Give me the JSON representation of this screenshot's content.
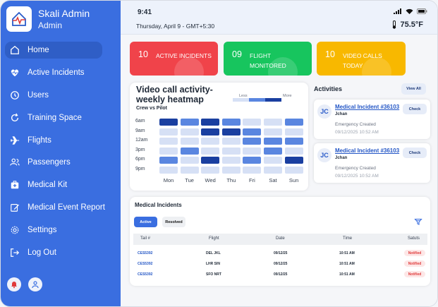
{
  "sidebar": {
    "title": "Skali Admin",
    "subtitle": "Admin",
    "items": [
      {
        "label": "Home",
        "icon": "home-icon"
      },
      {
        "label": "Active Incidents",
        "icon": "heartbeat-icon"
      },
      {
        "label": "Users",
        "icon": "clock-icon"
      },
      {
        "label": "Training Space",
        "icon": "refresh-icon"
      },
      {
        "label": "Flights",
        "icon": "plane-icon"
      },
      {
        "label": "Passengers",
        "icon": "users-icon"
      },
      {
        "label": "Medical Kit",
        "icon": "medkit-icon"
      },
      {
        "label": "Medical Event Report",
        "icon": "edit-icon"
      },
      {
        "label": "Settings",
        "icon": "gear-icon"
      },
      {
        "label": "Log Out",
        "icon": "logout-icon"
      }
    ]
  },
  "status": {
    "time": "9:41",
    "date": "Thursday, April 9 - GMT+5:30",
    "temperature": "75.5°F"
  },
  "stats": [
    {
      "number": "10",
      "label": "ACTIVE INCIDENTS",
      "color": "#f0434a"
    },
    {
      "number": "09",
      "label": "FLIGHT MONITORED",
      "color": "#17c55e"
    },
    {
      "number": "10",
      "label": "VIDEO CALLS TODAY",
      "color": "#f8b800"
    }
  ],
  "heatmap": {
    "title": "Video call activity- weekly heatmap",
    "subtitle": "Crew vs Pilot",
    "legend_less": "Less",
    "legend_more": "More",
    "rows": [
      "6am",
      "9am",
      "12am",
      "3pm",
      "6pm",
      "9pm"
    ],
    "cols": [
      "Mon",
      "Tue",
      "Wed",
      "Thu",
      "Fri",
      "Sat",
      "Sun"
    ],
    "levels": [
      [
        3,
        2,
        3,
        2,
        1,
        1,
        2
      ],
      [
        1,
        1,
        3,
        3,
        2,
        1,
        1
      ],
      [
        1,
        1,
        1,
        1,
        2,
        2,
        2
      ],
      [
        1,
        2,
        1,
        1,
        1,
        2,
        1
      ],
      [
        2,
        1,
        3,
        1,
        2,
        1,
        3
      ],
      [
        1,
        1,
        1,
        1,
        1,
        1,
        1
      ]
    ],
    "palette": [
      "#d6e0f5",
      "#5a86e0",
      "#1a3fa0"
    ]
  },
  "activities": {
    "title": "Activities",
    "view_all": "View All",
    "items": [
      {
        "initials": "JC",
        "title": "Medical Incident #36103",
        "name": "Jchan",
        "type": "Emergency Created",
        "time": "09/12/2025   10:52 AM",
        "action": "Check"
      },
      {
        "initials": "JC",
        "title": "Medical Incident #36103",
        "name": "Jchan",
        "type": "Emergency Created",
        "time": "09/12/2025   10:52 AM",
        "action": "Check"
      }
    ]
  },
  "incidents": {
    "title": "Medical Incidents",
    "tab_active": "Active",
    "tab_resolved": "Resolved",
    "headers": [
      "Tail #",
      "Flight",
      "Date",
      "Time",
      "Satuts"
    ],
    "rows": [
      {
        "tail": "CES5392",
        "flight": "DEL JKL",
        "date": "09/12/25",
        "time": "10:51 AM",
        "status": "Notified"
      },
      {
        "tail": "CES5392",
        "flight": "LHR SIN",
        "date": "09/12/25",
        "time": "10:51 AM",
        "status": "Notified"
      },
      {
        "tail": "CES5392",
        "flight": "SFO NRT",
        "date": "09/12/25",
        "time": "10:51 AM",
        "status": "Notified"
      }
    ]
  }
}
